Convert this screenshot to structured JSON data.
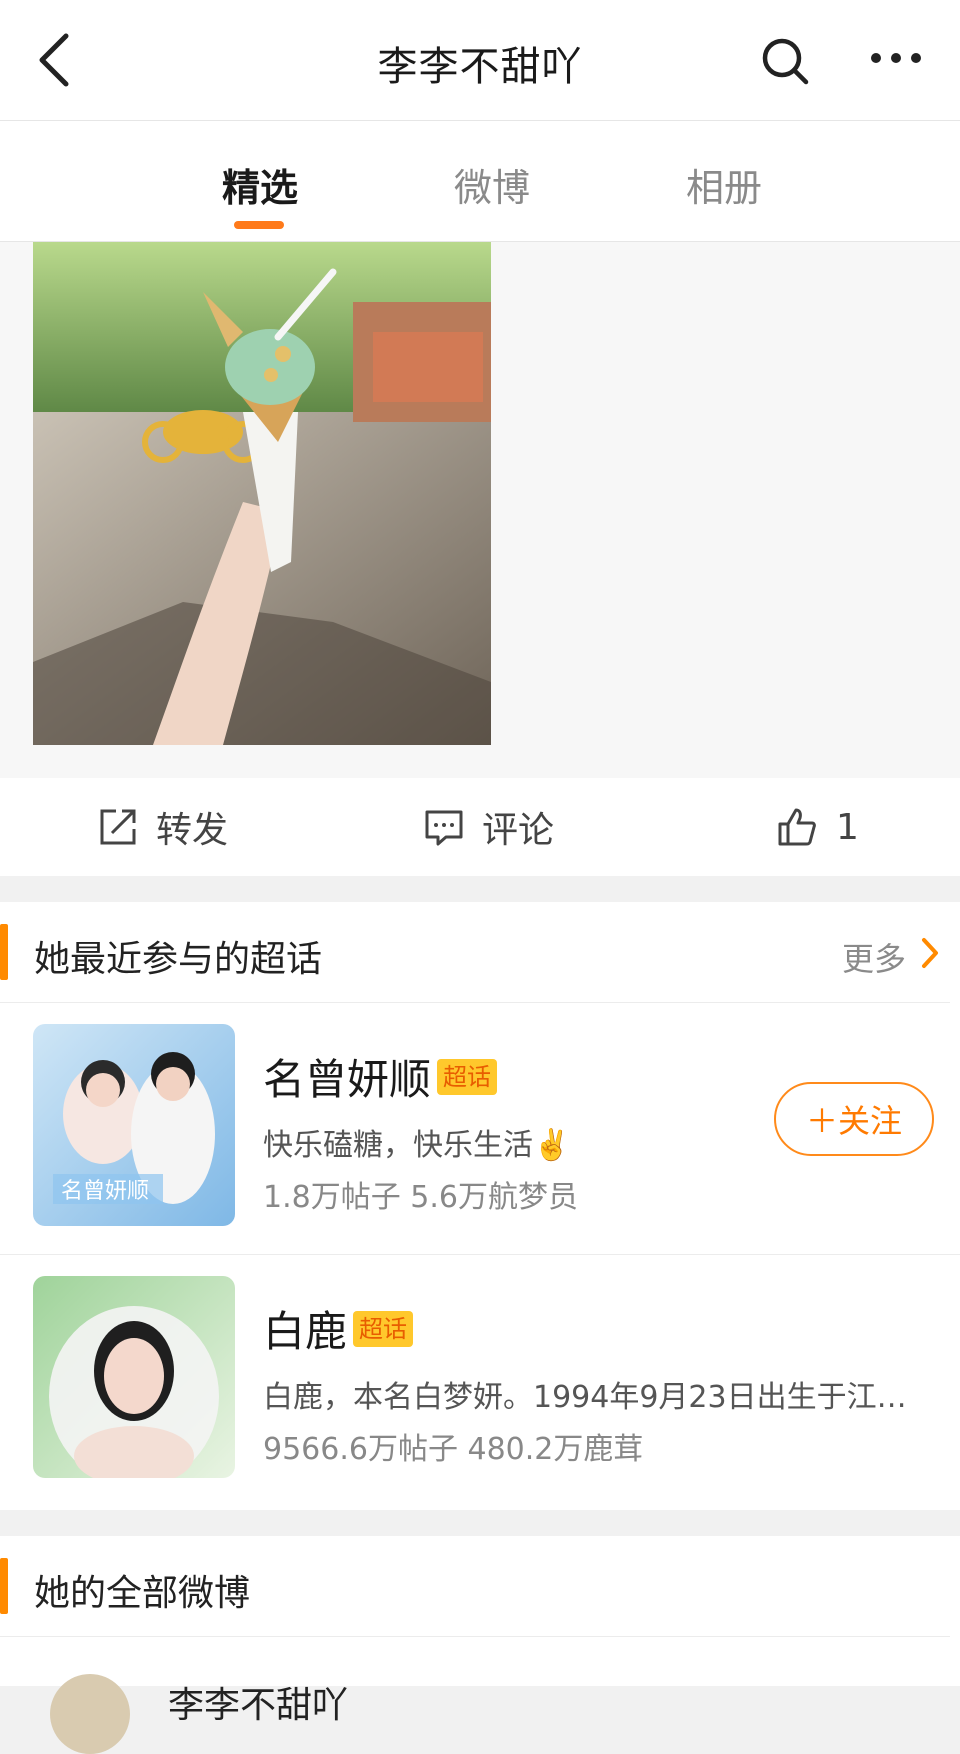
{
  "header": {
    "title": "李李不甜吖",
    "back_icon": "back-chevron-icon",
    "search_icon": "search-icon",
    "more_icon": "more-dots-icon"
  },
  "tabs": [
    {
      "label": "精选",
      "active": true
    },
    {
      "label": "微博",
      "active": false
    },
    {
      "label": "相册",
      "active": false
    }
  ],
  "accent_color": "#ff7a1a",
  "actions": {
    "repost_label": "转发",
    "comment_label": "评论",
    "like_count": "1"
  },
  "supertopics": {
    "section_title": "她最近参与的超话",
    "more_label": "更多",
    "items": [
      {
        "name": "名曾妍顺",
        "badge": "超话",
        "desc": "快乐磕糖，快乐生活✌️",
        "stats": "1.8万帖子 5.6万航梦员",
        "thumb_text": "名曾妍顺",
        "follow_label": "＋关注"
      },
      {
        "name": "白鹿",
        "badge": "超话",
        "desc": "白鹿，本名白梦妍。1994年9月23日出生于江…",
        "stats": "9566.6万帖子 480.2万鹿茸"
      }
    ]
  },
  "all_posts": {
    "section_title": "她的全部微博",
    "author_peek": "李李不甜吖"
  }
}
